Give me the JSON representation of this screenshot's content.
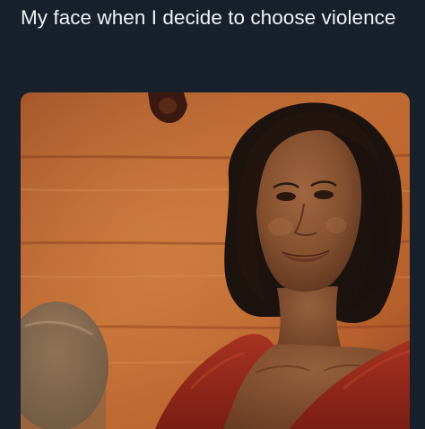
{
  "post": {
    "caption": "My face when I decide to choose violence"
  },
  "media": {
    "kind": "photo",
    "colors": {
      "page_background": "#17202b",
      "caption_text": "#eef2f5",
      "wall": "#b8642b",
      "hair": "#1c120e",
      "skin": "#8a5536",
      "top": "#9a2a1c"
    }
  }
}
